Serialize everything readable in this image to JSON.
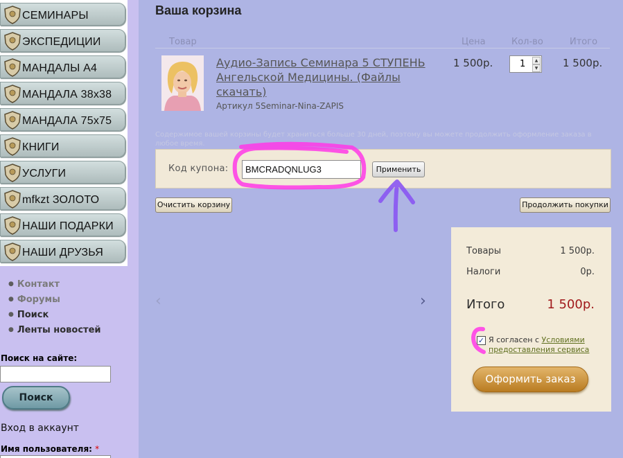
{
  "sidebar": {
    "categories": [
      {
        "label": "СЕМИНАРЫ"
      },
      {
        "label": "ЭКСПЕДИЦИИ"
      },
      {
        "label": "МАНДАЛЫ А4"
      },
      {
        "label": "МАНДАЛА 38х38"
      },
      {
        "label": "МАНДАЛА 75х75"
      },
      {
        "label": "КНИГИ"
      },
      {
        "label": "УСЛУГИ"
      },
      {
        "label": "mfkzt ЗОЛОТО"
      },
      {
        "label": "НАШИ ПОДАРКИ"
      },
      {
        "label": "НАШИ ДРУЗЬЯ"
      }
    ],
    "links": [
      {
        "label": "Контакт"
      },
      {
        "label": "Форумы"
      },
      {
        "label": "Поиск"
      },
      {
        "label": "Ленты новостей"
      }
    ],
    "search": {
      "label": "Поиск на сайте:",
      "button": "Поиск",
      "value": ""
    },
    "login": {
      "heading": "Вход в аккаунт",
      "username_label": "Имя пользователя:",
      "required_mark": "*"
    }
  },
  "cart": {
    "title": "Ваша корзина",
    "columns": {
      "product": "Товар",
      "price": "Цена",
      "qty": "Кол-во",
      "total": "Итого"
    },
    "item": {
      "title": "Аудио-Запись Семинара 5 СТУПЕНЬ Ангельской Медицины. (Файлы скачать)",
      "sku": "Артикул 5Seminar-Nina-ZAPIS",
      "price": "1 500р.",
      "qty": "1",
      "total": "1 500р."
    },
    "storage_note": "Содержимое вашей корзины будет храниться больше 30 дней, поэтому вы можете продолжить оформление заказа в любое время.",
    "coupon": {
      "label": "Код купона:",
      "value": "BMCRADQNLUG3",
      "button": "Применить"
    },
    "clear_button": "Очистить корзину",
    "continue_button": "Продолжить покупки",
    "carousel": {
      "prev_icon": "‹",
      "next_icon": "›"
    }
  },
  "summary": {
    "goods_label": "Товары",
    "goods_value": "1 500р.",
    "tax_label": "Налоги",
    "tax_value": "0р.",
    "total_label": "Итого",
    "total_value": "1 500р.",
    "terms_prefix": "Я согласен с",
    "terms_link": "Условиями предоставления сервиса",
    "terms_checked": true,
    "checkout_button": "Оформить заказ"
  },
  "colors": {
    "page_bg": "#aeb4e4",
    "sidebar_bg": "#c9c0f0",
    "summary_bg": "#f3ebd9",
    "total_price": "#a0191b",
    "annotation_pink": "#ff38e8",
    "annotation_arrow": "#8a55f2"
  }
}
